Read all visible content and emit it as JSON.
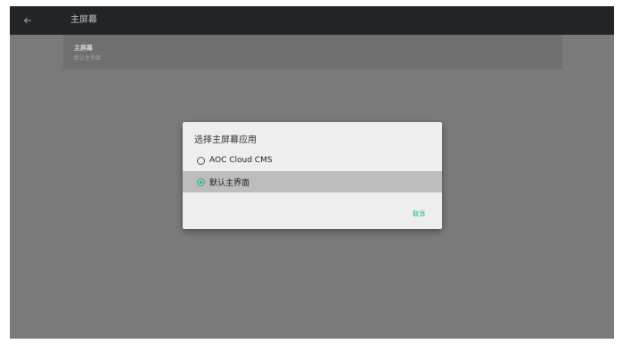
{
  "appbar": {
    "back_icon": "arrow-left-icon",
    "title": "主屏幕"
  },
  "preference": {
    "title": "主屏幕",
    "summary": "默认主界面"
  },
  "dialog": {
    "title": "选择主屏幕应用",
    "options": [
      {
        "label": "AOC Cloud CMS",
        "selected": false
      },
      {
        "label": "默认主界面",
        "selected": true
      }
    ],
    "cancel_label": "取消"
  },
  "colors": {
    "accent": "#1fb38a",
    "appbar": "#222527",
    "scrim": "#7a7a7a",
    "dialog": "#eeeeee",
    "selected_row": "#bdbdbd"
  }
}
